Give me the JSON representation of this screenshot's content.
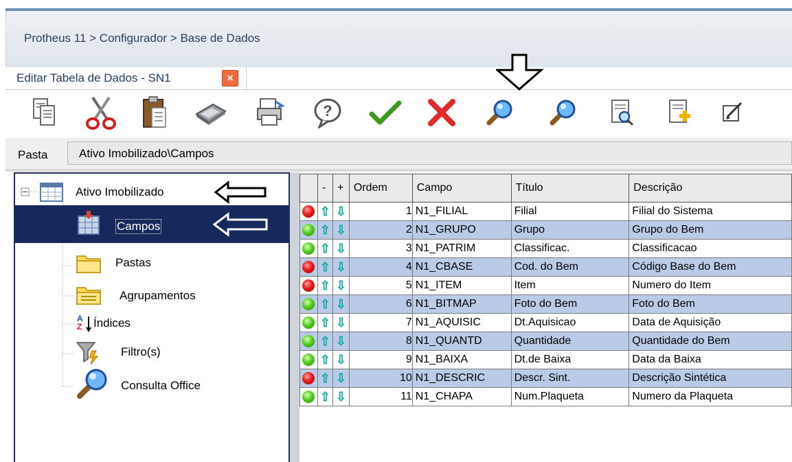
{
  "breadcrumb": "Protheus 11 > Configurador > Base de Dados",
  "tab": {
    "label": "Editar Tabela de Dados - SN1",
    "close": "×"
  },
  "toolbar": {
    "buttons": [
      {
        "name": "copy-icon"
      },
      {
        "name": "cut-icon"
      },
      {
        "name": "paste-icon"
      },
      {
        "name": "calculator-icon"
      },
      {
        "name": "print-icon"
      },
      {
        "name": "help-icon"
      },
      {
        "name": "confirm-icon"
      },
      {
        "name": "cancel-icon"
      },
      {
        "name": "search-icon"
      },
      {
        "name": "search-next-icon"
      },
      {
        "name": "preview-icon"
      },
      {
        "name": "new-document-icon"
      },
      {
        "name": "edit-icon"
      }
    ]
  },
  "pasta": {
    "label": "Pasta",
    "value": "Ativo Imobilizado\\Campos"
  },
  "tree": {
    "root": "Ativo Imobilizado",
    "items": [
      "Campos",
      "Pastas",
      "Agrupamentos",
      "Índices",
      "Filtro(s)",
      "Consulta Office"
    ],
    "sort_glyph_a": "A",
    "sort_glyph_z": "Z"
  },
  "grid": {
    "headers": [
      "",
      "-",
      "+",
      "Ordem",
      "Campo",
      "Título",
      "Descrição"
    ],
    "rows": [
      {
        "status": "red",
        "ordem": "1",
        "campo": "N1_FILIAL",
        "titulo": "Filial",
        "descricao": "Filial do Sistema"
      },
      {
        "status": "green",
        "ordem": "2",
        "campo": "N1_GRUPO",
        "titulo": "Grupo",
        "descricao": "Grupo do Bem"
      },
      {
        "status": "green",
        "ordem": "3",
        "campo": "N1_PATRIM",
        "titulo": "Classificac.",
        "descricao": "Classificacao"
      },
      {
        "status": "red",
        "ordem": "4",
        "campo": "N1_CBASE",
        "titulo": "Cod. do Bem",
        "descricao": "Código Base do Bem"
      },
      {
        "status": "red",
        "ordem": "5",
        "campo": "N1_ITEM",
        "titulo": "Item",
        "descricao": "Numero do Item"
      },
      {
        "status": "green",
        "ordem": "6",
        "campo": "N1_BITMAP",
        "titulo": "Foto do Bem",
        "descricao": "Foto do Bem"
      },
      {
        "status": "green",
        "ordem": "7",
        "campo": "N1_AQUISIC",
        "titulo": "Dt.Aquisicao",
        "descricao": "Data de Aquisição"
      },
      {
        "status": "green",
        "ordem": "8",
        "campo": "N1_QUANTD",
        "titulo": "Quantidade",
        "descricao": "Quantidade do Bem"
      },
      {
        "status": "green",
        "ordem": "9",
        "campo": "N1_BAIXA",
        "titulo": "Dt.de Baixa",
        "descricao": "Data da Baixa"
      },
      {
        "status": "red",
        "ordem": "10",
        "campo": "N1_DESCRIC",
        "titulo": "Descr. Sint.",
        "descricao": "Descrição Sintética"
      },
      {
        "status": "green",
        "ordem": "11",
        "campo": "N1_CHAPA",
        "titulo": "Num.Plaqueta",
        "descricao": "Numero da Plaqueta"
      }
    ],
    "up_glyph": "⇧",
    "down_glyph": "⇩"
  },
  "colors": {
    "accent": "#16295d",
    "row_alt": "#b9cbe6",
    "status_red": "#e81b1b",
    "status_green": "#52cf1f"
  }
}
